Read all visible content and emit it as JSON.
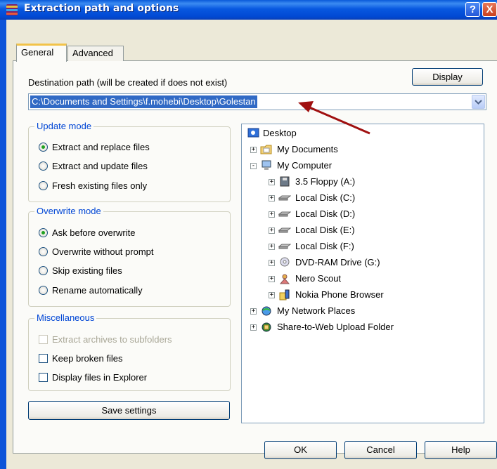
{
  "window": {
    "title": "Extraction path and options",
    "help_label": "?",
    "close_label": "X"
  },
  "tabs": [
    {
      "label": "General"
    },
    {
      "label": "Advanced"
    }
  ],
  "destination": {
    "label": "Destination path (will be created if does not exist)",
    "value": "C:\\Documents and Settings\\f.mohebi\\Desktop\\Golestan",
    "display_button": "Display"
  },
  "update_mode": {
    "title": "Update mode",
    "options": [
      "Extract and replace files",
      "Extract and update files",
      "Fresh existing files only"
    ],
    "selected": 0
  },
  "overwrite_mode": {
    "title": "Overwrite mode",
    "options": [
      "Ask before overwrite",
      "Overwrite without prompt",
      "Skip existing files",
      "Rename automatically"
    ],
    "selected": 0
  },
  "misc": {
    "title": "Miscellaneous",
    "options": [
      {
        "label": "Extract archives to subfolders",
        "checked": false,
        "disabled": true
      },
      {
        "label": "Keep broken files",
        "checked": false,
        "disabled": false
      },
      {
        "label": "Display files in Explorer",
        "checked": false,
        "disabled": false
      }
    ]
  },
  "save_settings_label": "Save settings",
  "tree": {
    "items": [
      {
        "label": "Desktop",
        "icon": "desktop-icon",
        "expander": ""
      },
      {
        "label": "My Documents",
        "icon": "folder-icon",
        "expander": "+"
      },
      {
        "label": "My Computer",
        "icon": "computer-icon",
        "expander": "-"
      },
      {
        "label": "3.5 Floppy (A:)",
        "icon": "floppy-icon",
        "expander": "+"
      },
      {
        "label": "Local Disk (C:)",
        "icon": "disk-icon",
        "expander": "+"
      },
      {
        "label": "Local Disk (D:)",
        "icon": "disk-icon",
        "expander": "+"
      },
      {
        "label": "Local Disk (E:)",
        "icon": "disk-icon",
        "expander": "+"
      },
      {
        "label": "Local Disk (F:)",
        "icon": "disk-icon",
        "expander": "+"
      },
      {
        "label": "DVD-RAM Drive (G:)",
        "icon": "dvd-icon",
        "expander": "+"
      },
      {
        "label": "Nero Scout",
        "icon": "nero-icon",
        "expander": "+"
      },
      {
        "label": "Nokia Phone Browser",
        "icon": "phone-icon",
        "expander": "+"
      },
      {
        "label": "My Network Places",
        "icon": "network-icon",
        "expander": "+"
      },
      {
        "label": "Share-to-Web Upload Folder",
        "icon": "web-folder-icon",
        "expander": "+"
      }
    ]
  },
  "buttons": {
    "ok": "OK",
    "cancel": "Cancel",
    "help": "Help"
  },
  "colors": {
    "title_bar": "#0858e0",
    "selection": "#316ac5",
    "group_title": "#0046d5",
    "annotation_arrow": "#a01010"
  }
}
